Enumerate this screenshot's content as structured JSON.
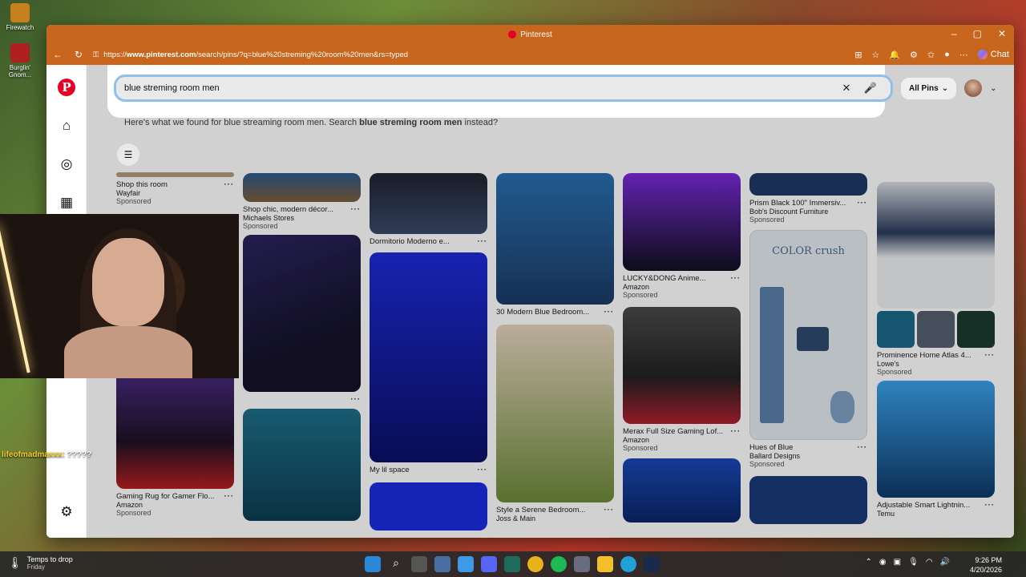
{
  "desktop": {
    "icons": [
      {
        "label": "Firewatch"
      },
      {
        "label": "Burglin' Gnom..."
      }
    ]
  },
  "browser": {
    "window_title": "Pinterest",
    "url_prefix": "https://",
    "url_domain": "www.pinterest.com",
    "url_path": "/search/pins/?q=blue%20streming%20room%20men&rs=typed",
    "chat_label": "Chat"
  },
  "search": {
    "value": "blue streming room men",
    "scope_label": "All Pins",
    "suggestion_prefix": "Here's what we found for blue streaming room men. Search ",
    "suggestion_query": "blue streming room men",
    "suggestion_suffix": " instead?"
  },
  "pins": {
    "col1": [
      {
        "title": "Shop this room",
        "source": "Wayfair",
        "sponsored": "Sponsored",
        "color": "#b39b7c"
      },
      {
        "title": "Gaming Rug for Gamer Flo...",
        "source": "Amazon",
        "sponsored": "Sponsored",
        "color": "#3a1e4e"
      }
    ],
    "col2": [
      {
        "title": "Shop chic, modern décor...",
        "source": "Michaels Stores",
        "sponsored": "Sponsored",
        "color": "#2d5b8f"
      },
      {
        "title": "",
        "source": "",
        "sponsored": "",
        "color": "#1f1c3a"
      },
      {
        "title": "",
        "source": "",
        "sponsored": "",
        "color": "#1e6f8a"
      }
    ],
    "col3": [
      {
        "title": "Dormitorio Moderno e...",
        "source": "",
        "sponsored": "",
        "color": "#1f2430"
      },
      {
        "title": "My lil space",
        "source": "",
        "sponsored": "",
        "color": "#1d2bd8"
      },
      {
        "title": "",
        "source": "",
        "sponsored": "",
        "color": "#1a2ee0"
      }
    ],
    "col4": [
      {
        "title": "30 Modern Blue Bedroom...",
        "source": "",
        "sponsored": "",
        "color": "#2a6fb0"
      },
      {
        "title": "Style a Serene Bedroom...",
        "source": "Joss & Main",
        "sponsored": "",
        "color": "#6d8a3a"
      }
    ],
    "col5": [
      {
        "title": "LUCKY&DONG Anime...",
        "source": "Amazon",
        "sponsored": "Sponsored",
        "color": "#5a2ba8"
      },
      {
        "title": "Merax Full Size Gaming Lof...",
        "source": "Amazon",
        "sponsored": "Sponsored",
        "color": "#3c3c3c"
      },
      {
        "title": "",
        "source": "",
        "sponsored": "",
        "color": "#1a48b8"
      }
    ],
    "col6": [
      {
        "title": "Prism Black 100\" Immersiv...",
        "source": "Bob's Discount Furniture",
        "sponsored": "Sponsored",
        "color": "#1e3a66"
      },
      {
        "title": "Hues of Blue",
        "source": "Ballard Designs",
        "sponsored": "Sponsored",
        "color": "#dfe7ec",
        "overlay": "COLOR crush"
      },
      {
        "title": "",
        "source": "",
        "sponsored": "",
        "color": "#1c3a78"
      }
    ],
    "col7": [
      {
        "title": "Prominence Home Atlas 4...",
        "source": "Lowe's",
        "sponsored": "Sponsored",
        "color": "#9aa4b4"
      },
      {
        "title": "Adjustable Smart Lightnin...",
        "source": "Temu",
        "sponsored": "",
        "color": "#1f6fb4"
      }
    ]
  },
  "overlay": {
    "chat_user": "lifeofmadmaxxx:",
    "chat_message": "?????"
  },
  "taskbar": {
    "weather_title": "Temps to drop",
    "weather_day": "Friday",
    "time": "9:26 PM",
    "date": "4/20/2026"
  }
}
